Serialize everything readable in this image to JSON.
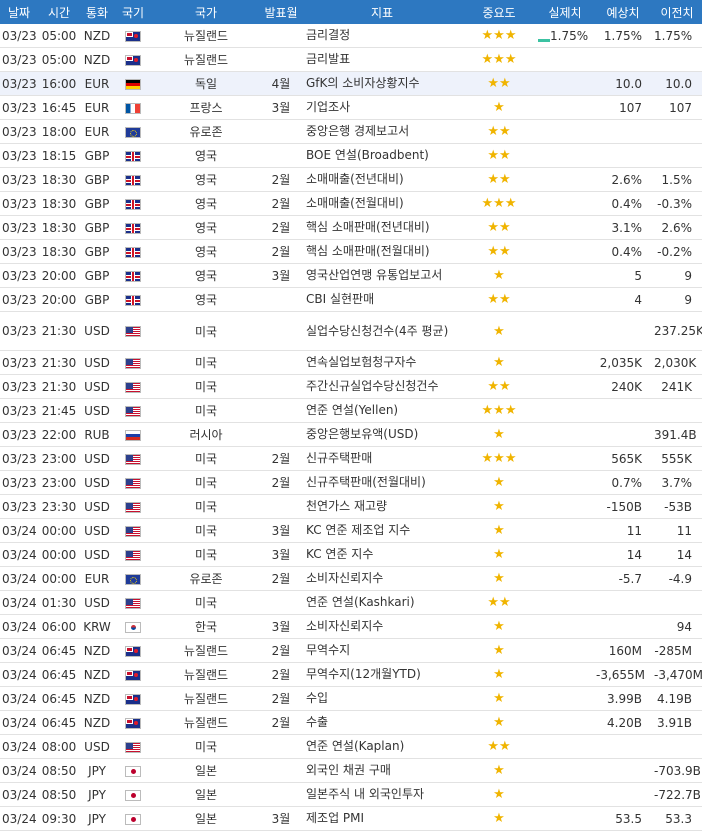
{
  "header": {
    "date": "날짜",
    "time": "시간",
    "currency": "통화",
    "flag": "국기",
    "country": "국가",
    "period": "발표월",
    "indicator": "지표",
    "importance": "중요도",
    "actual": "실제치",
    "forecast": "예상치",
    "previous": "이전치"
  },
  "colors": {
    "header_bg": "#2d78c1",
    "star": "#f0b400",
    "highlight_row": "#eef2fb",
    "indicator_bar": "#3cc2a2"
  },
  "rows": [
    {
      "date": "03/23",
      "time": "05:00",
      "currency": "NZD",
      "flag": "nz-flag-icon",
      "country": "뉴질랜드",
      "period": "",
      "event": "금리결정",
      "stars": "★★★",
      "actual": "1.75%",
      "forecast": "1.75%",
      "previous": "1.75%",
      "bar": true
    },
    {
      "date": "03/23",
      "time": "05:00",
      "currency": "NZD",
      "flag": "nz-flag-icon",
      "country": "뉴질랜드",
      "period": "",
      "event": "금리발표",
      "stars": "★★★",
      "actual": "",
      "forecast": "",
      "previous": ""
    },
    {
      "date": "03/23",
      "time": "16:00",
      "currency": "EUR",
      "flag": "de-flag-icon",
      "country": "독일",
      "period": "4월",
      "event": "GfK의 소비자상황지수",
      "stars": "★★",
      "actual": "",
      "forecast": "10.0",
      "previous": "10.0",
      "highlight": true
    },
    {
      "date": "03/23",
      "time": "16:45",
      "currency": "EUR",
      "flag": "fr-flag-icon",
      "country": "프랑스",
      "period": "3월",
      "event": "기업조사",
      "stars": "★",
      "actual": "",
      "forecast": "107",
      "previous": "107"
    },
    {
      "date": "03/23",
      "time": "18:00",
      "currency": "EUR",
      "flag": "eu-flag-icon",
      "country": "유로존",
      "period": "",
      "event": "중앙은행 경제보고서",
      "stars": "★★",
      "actual": "",
      "forecast": "",
      "previous": ""
    },
    {
      "date": "03/23",
      "time": "18:15",
      "currency": "GBP",
      "flag": "gb-flag-icon",
      "country": "영국",
      "period": "",
      "event": "BOE 연설(Broadbent)",
      "stars": "★★",
      "actual": "",
      "forecast": "",
      "previous": ""
    },
    {
      "date": "03/23",
      "time": "18:30",
      "currency": "GBP",
      "flag": "gb-flag-icon",
      "country": "영국",
      "period": "2월",
      "event": "소매매출(전년대비)",
      "stars": "★★",
      "actual": "",
      "forecast": "2.6%",
      "previous": "1.5%"
    },
    {
      "date": "03/23",
      "time": "18:30",
      "currency": "GBP",
      "flag": "gb-flag-icon",
      "country": "영국",
      "period": "2월",
      "event": "소매매출(전월대비)",
      "stars": "★★★",
      "actual": "",
      "forecast": "0.4%",
      "previous": "-0.3%"
    },
    {
      "date": "03/23",
      "time": "18:30",
      "currency": "GBP",
      "flag": "gb-flag-icon",
      "country": "영국",
      "period": "2월",
      "event": "핵심 소매판매(전년대비)",
      "stars": "★★",
      "actual": "",
      "forecast": "3.1%",
      "previous": "2.6%"
    },
    {
      "date": "03/23",
      "time": "18:30",
      "currency": "GBP",
      "flag": "gb-flag-icon",
      "country": "영국",
      "period": "2월",
      "event": "핵심 소매판매(전월대비)",
      "stars": "★★",
      "actual": "",
      "forecast": "0.4%",
      "previous": "-0.2%"
    },
    {
      "date": "03/23",
      "time": "20:00",
      "currency": "GBP",
      "flag": "gb-flag-icon",
      "country": "영국",
      "period": "3월",
      "event": "영국산업연맹 유통업보고서",
      "stars": "★",
      "actual": "",
      "forecast": "5",
      "previous": "9"
    },
    {
      "date": "03/23",
      "time": "20:00",
      "currency": "GBP",
      "flag": "gb-flag-icon",
      "country": "영국",
      "period": "",
      "event": "CBI 실현판매",
      "stars": "★★",
      "actual": "",
      "forecast": "4",
      "previous": "9"
    },
    {
      "date": "03/23",
      "time": "21:30",
      "currency": "USD",
      "flag": "us-flag-icon",
      "country": "미국",
      "period": "",
      "event": "실업수당신청건수(4주 평균)",
      "stars": "★",
      "actual": "",
      "forecast": "",
      "previous": "237.25K",
      "tall": true
    },
    {
      "date": "03/23",
      "time": "21:30",
      "currency": "USD",
      "flag": "us-flag-icon",
      "country": "미국",
      "period": "",
      "event": "연속실업보험청구자수",
      "stars": "★",
      "actual": "",
      "forecast": "2,035K",
      "previous": "2,030K"
    },
    {
      "date": "03/23",
      "time": "21:30",
      "currency": "USD",
      "flag": "us-flag-icon",
      "country": "미국",
      "period": "",
      "event": "주간신규실업수당신청건수",
      "stars": "★★",
      "actual": "",
      "forecast": "240K",
      "previous": "241K"
    },
    {
      "date": "03/23",
      "time": "21:45",
      "currency": "USD",
      "flag": "us-flag-icon",
      "country": "미국",
      "period": "",
      "event": "연준 연설(Yellen)",
      "stars": "★★★",
      "actual": "",
      "forecast": "",
      "previous": ""
    },
    {
      "date": "03/23",
      "time": "22:00",
      "currency": "RUB",
      "flag": "ru-flag-icon",
      "country": "러시아",
      "period": "",
      "event": "중앙은행보유액(USD)",
      "stars": "★",
      "actual": "",
      "forecast": "",
      "previous": "391.4B"
    },
    {
      "date": "03/23",
      "time": "23:00",
      "currency": "USD",
      "flag": "us-flag-icon",
      "country": "미국",
      "period": "2월",
      "event": "신규주택판매",
      "stars": "★★★",
      "actual": "",
      "forecast": "565K",
      "previous": "555K"
    },
    {
      "date": "03/23",
      "time": "23:00",
      "currency": "USD",
      "flag": "us-flag-icon",
      "country": "미국",
      "period": "2월",
      "event": "신규주택판매(전월대비)",
      "stars": "★",
      "actual": "",
      "forecast": "0.7%",
      "previous": "3.7%"
    },
    {
      "date": "03/23",
      "time": "23:30",
      "currency": "USD",
      "flag": "us-flag-icon",
      "country": "미국",
      "period": "",
      "event": "천연가스 재고량",
      "stars": "★",
      "actual": "",
      "forecast": "-150B",
      "previous": "-53B"
    },
    {
      "date": "03/24",
      "time": "00:00",
      "currency": "USD",
      "flag": "us-flag-icon",
      "country": "미국",
      "period": "3월",
      "event": "KC 연준 제조업 지수",
      "stars": "★",
      "actual": "",
      "forecast": "11",
      "previous": "11"
    },
    {
      "date": "03/24",
      "time": "00:00",
      "currency": "USD",
      "flag": "us-flag-icon",
      "country": "미국",
      "period": "3월",
      "event": "KC 연준 지수",
      "stars": "★",
      "actual": "",
      "forecast": "14",
      "previous": "14"
    },
    {
      "date": "03/24",
      "time": "00:00",
      "currency": "EUR",
      "flag": "eu-flag-icon",
      "country": "유로존",
      "period": "2월",
      "event": "소비자신뢰지수",
      "stars": "★",
      "actual": "",
      "forecast": "-5.7",
      "previous": "-4.9"
    },
    {
      "date": "03/24",
      "time": "01:30",
      "currency": "USD",
      "flag": "us-flag-icon",
      "country": "미국",
      "period": "",
      "event": "연준 연설(Kashkari)",
      "stars": "★★",
      "actual": "",
      "forecast": "",
      "previous": ""
    },
    {
      "date": "03/24",
      "time": "06:00",
      "currency": "KRW",
      "flag": "kr-flag-icon",
      "country": "한국",
      "period": "3월",
      "event": "소비자신뢰지수",
      "stars": "★",
      "actual": "",
      "forecast": "",
      "previous": "94"
    },
    {
      "date": "03/24",
      "time": "06:45",
      "currency": "NZD",
      "flag": "nz-flag-icon",
      "country": "뉴질랜드",
      "period": "2월",
      "event": "무역수지",
      "stars": "★",
      "actual": "",
      "forecast": "160M",
      "previous": "-285M"
    },
    {
      "date": "03/24",
      "time": "06:45",
      "currency": "NZD",
      "flag": "nz-flag-icon",
      "country": "뉴질랜드",
      "period": "2월",
      "event": "무역수지(12개월YTD)",
      "stars": "★",
      "actual": "",
      "forecast": "-3,655M",
      "previous": "-3,470M"
    },
    {
      "date": "03/24",
      "time": "06:45",
      "currency": "NZD",
      "flag": "nz-flag-icon",
      "country": "뉴질랜드",
      "period": "2월",
      "event": "수입",
      "stars": "★",
      "actual": "",
      "forecast": "3.99B",
      "previous": "4.19B"
    },
    {
      "date": "03/24",
      "time": "06:45",
      "currency": "NZD",
      "flag": "nz-flag-icon",
      "country": "뉴질랜드",
      "period": "2월",
      "event": "수출",
      "stars": "★",
      "actual": "",
      "forecast": "4.20B",
      "previous": "3.91B"
    },
    {
      "date": "03/24",
      "time": "08:00",
      "currency": "USD",
      "flag": "us-flag-icon",
      "country": "미국",
      "period": "",
      "event": "연준 연설(Kaplan)",
      "stars": "★★",
      "actual": "",
      "forecast": "",
      "previous": ""
    },
    {
      "date": "03/24",
      "time": "08:50",
      "currency": "JPY",
      "flag": "jp-flag-icon",
      "country": "일본",
      "period": "",
      "event": "외국인 채권 구매",
      "stars": "★",
      "actual": "",
      "forecast": "",
      "previous": "-703.9B"
    },
    {
      "date": "03/24",
      "time": "08:50",
      "currency": "JPY",
      "flag": "jp-flag-icon",
      "country": "일본",
      "period": "",
      "event": "일본주식 내 외국인투자",
      "stars": "★",
      "actual": "",
      "forecast": "",
      "previous": "-722.7B"
    },
    {
      "date": "03/24",
      "time": "09:30",
      "currency": "JPY",
      "flag": "jp-flag-icon",
      "country": "일본",
      "period": "3월",
      "event": "제조업 PMI",
      "stars": "★",
      "actual": "",
      "forecast": "53.5",
      "previous": "53.3"
    }
  ]
}
